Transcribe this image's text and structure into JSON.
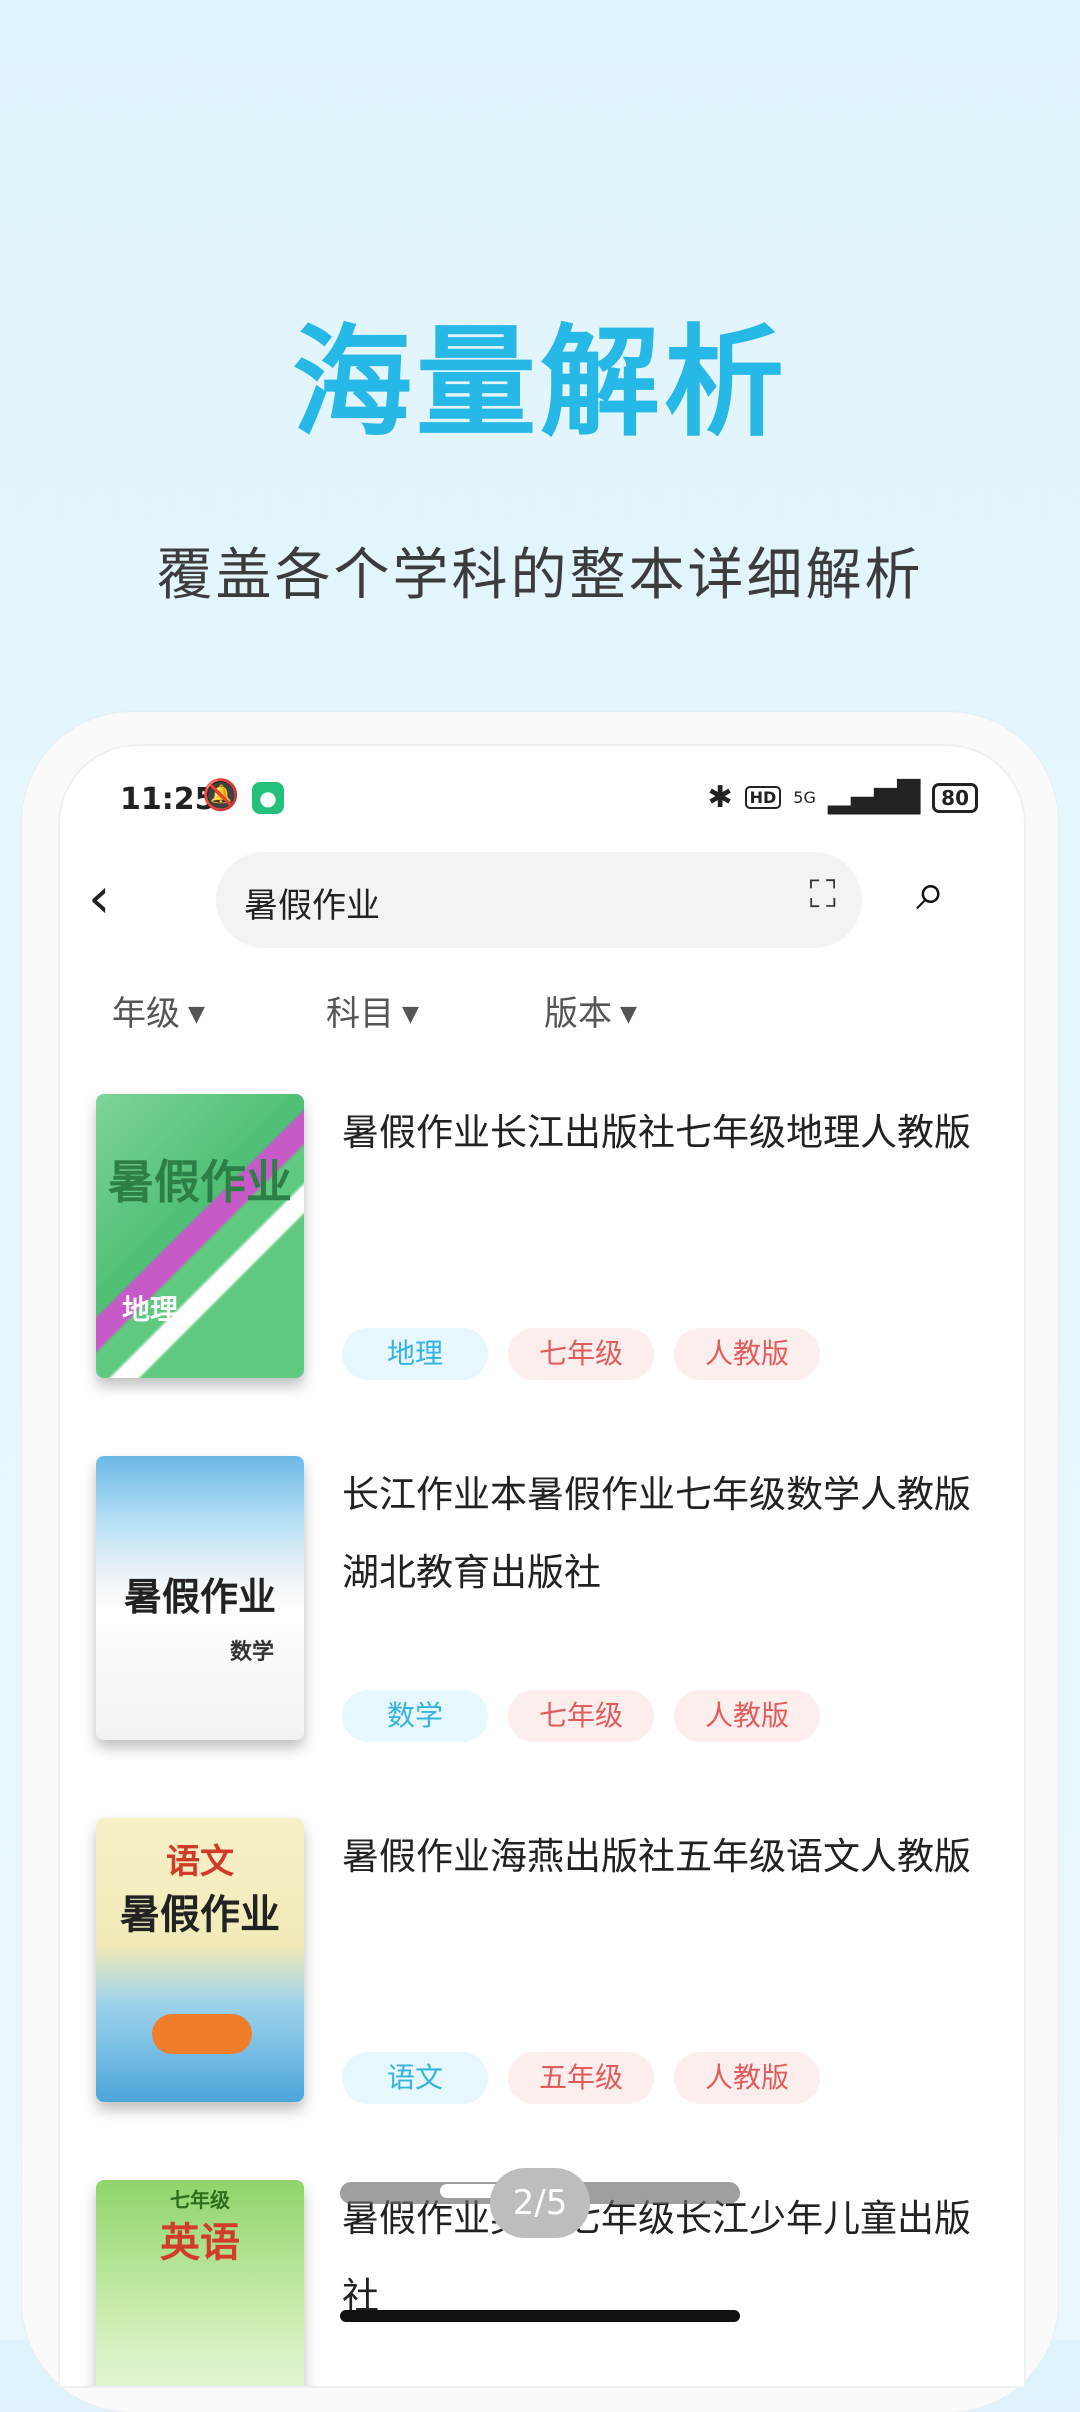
{
  "promo": {
    "headline": "海量解析",
    "subheadline": "覆盖各个学科的整本详细解析"
  },
  "status_bar": {
    "time": "11:25",
    "network": "5G",
    "battery": "80"
  },
  "search": {
    "query": "暑假作业"
  },
  "filters": [
    {
      "label": "年级"
    },
    {
      "label": "科目"
    },
    {
      "label": "版本"
    }
  ],
  "results": [
    {
      "title": "暑假作业长江出版社七年级地理人教版",
      "cover_text": "暑假作业",
      "cover_subject": "地理",
      "tags": [
        "地理",
        "七年级",
        "人教版"
      ]
    },
    {
      "title": "长江作业本暑假作业七年级数学人教版湖北教育出版社",
      "cover_text": "暑假作业",
      "cover_subject": "数学",
      "tags": [
        "数学",
        "七年级",
        "人教版"
      ]
    },
    {
      "title": "暑假作业海燕出版社五年级语文人教版",
      "cover_text": "暑假作业",
      "cover_subject": "语文",
      "tags": [
        "语文",
        "五年级",
        "人教版"
      ]
    },
    {
      "title": "暑假作业英语七年级长江少年儿童出版社",
      "cover_text": "英语",
      "cover_subject": "七年级",
      "tags": []
    }
  ],
  "pager": "2/5",
  "colors": {
    "accent": "#26b8e6",
    "tag_subject_bg": "#e6f7fd",
    "tag_subject_fg": "#35b4e2",
    "tag_red_bg": "#fdeeee",
    "tag_red_fg": "#e25c5c"
  }
}
